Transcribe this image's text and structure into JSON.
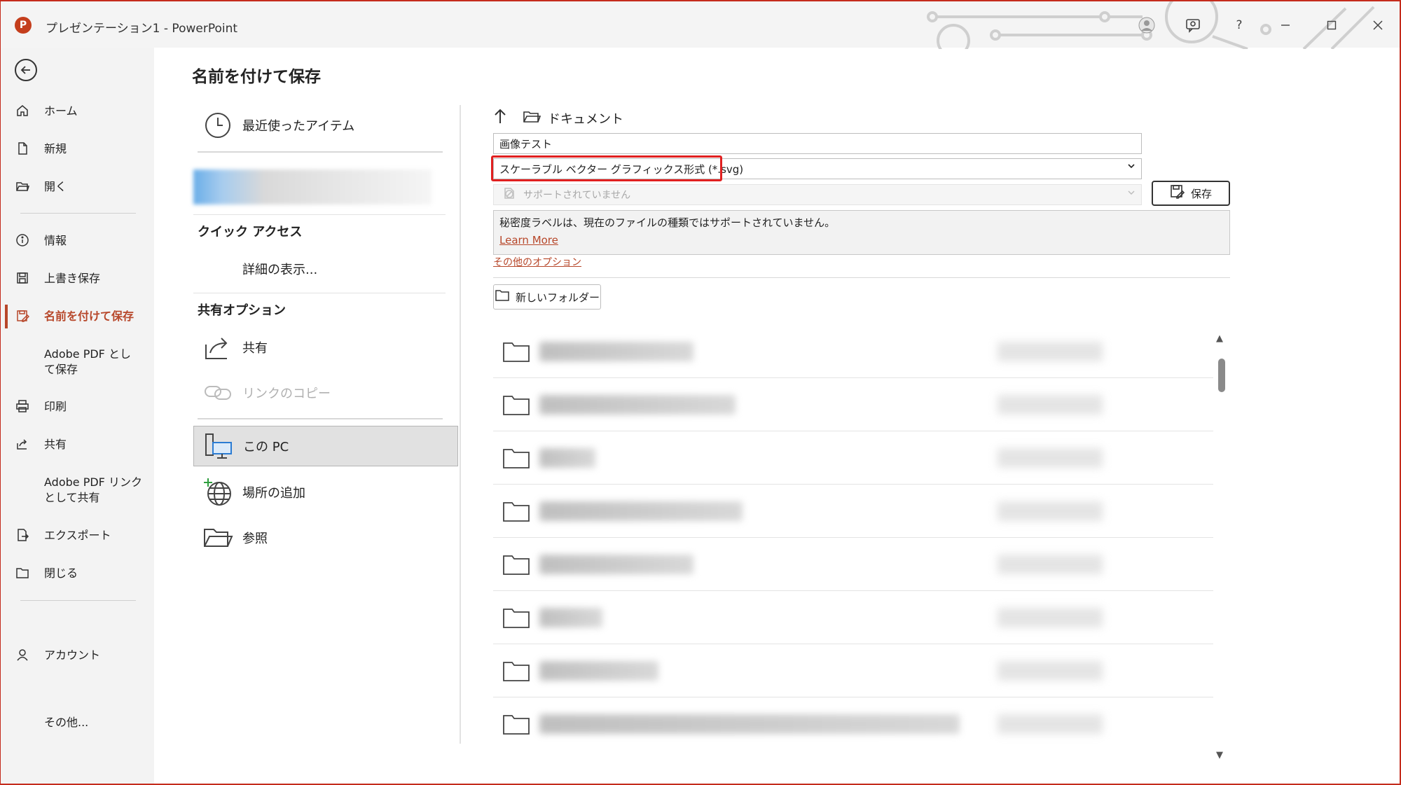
{
  "window": {
    "logo_letter": "P",
    "title": "プレゼンテーション1  -  PowerPoint",
    "help_label": "?"
  },
  "nav": {
    "items": [
      {
        "label": "ホーム",
        "icon": "home-icon"
      },
      {
        "label": "新規",
        "icon": "new-document-icon"
      },
      {
        "label": "開く",
        "icon": "open-folder-icon"
      },
      {
        "label": "情報",
        "icon": "info-icon"
      },
      {
        "label": "上書き保存",
        "icon": "save-icon"
      },
      {
        "label": "名前を付けて保存",
        "icon": "save-as-icon",
        "active": true
      },
      {
        "label": "Adobe PDF として保存",
        "icon": ""
      },
      {
        "label": "印刷",
        "icon": "print-icon"
      },
      {
        "label": "共有",
        "icon": "share-icon"
      },
      {
        "label": "Adobe PDF リンクとして共有",
        "icon": ""
      },
      {
        "label": "エクスポート",
        "icon": "export-icon"
      },
      {
        "label": "閉じる",
        "icon": "close-folder-icon"
      },
      {
        "label": "アカウント",
        "icon": "account-icon"
      },
      {
        "label": "その他...",
        "icon": ""
      }
    ]
  },
  "page": {
    "title": "名前を付けて保存"
  },
  "locations": {
    "recent": "最近使ったアイテム",
    "quick_access_header": "クイック アクセス",
    "show_more": "詳細の表示...",
    "share_options_header": "共有オプション",
    "share": "共有",
    "copy_link": "リンクのコピー",
    "this_pc": "この PC",
    "add_place": "場所の追加",
    "browse": "参照"
  },
  "file_pane": {
    "current_folder": "ドキュメント",
    "file_name": "画像テスト",
    "file_type": "スケーラブル ベクター グラフィックス形式 (*.svg)",
    "sensitivity": "サポートされていません",
    "save_label": "保存",
    "info_text": "秘密度ラベルは、現在のファイルの種類ではサポートされていません。",
    "learn_more": "Learn More",
    "more_options": "その他のオプション",
    "new_folder": "新しいフォルダー"
  },
  "colors": {
    "accent": "#b7472a",
    "highlight": "#e02020",
    "frame": "#c42b1c"
  }
}
